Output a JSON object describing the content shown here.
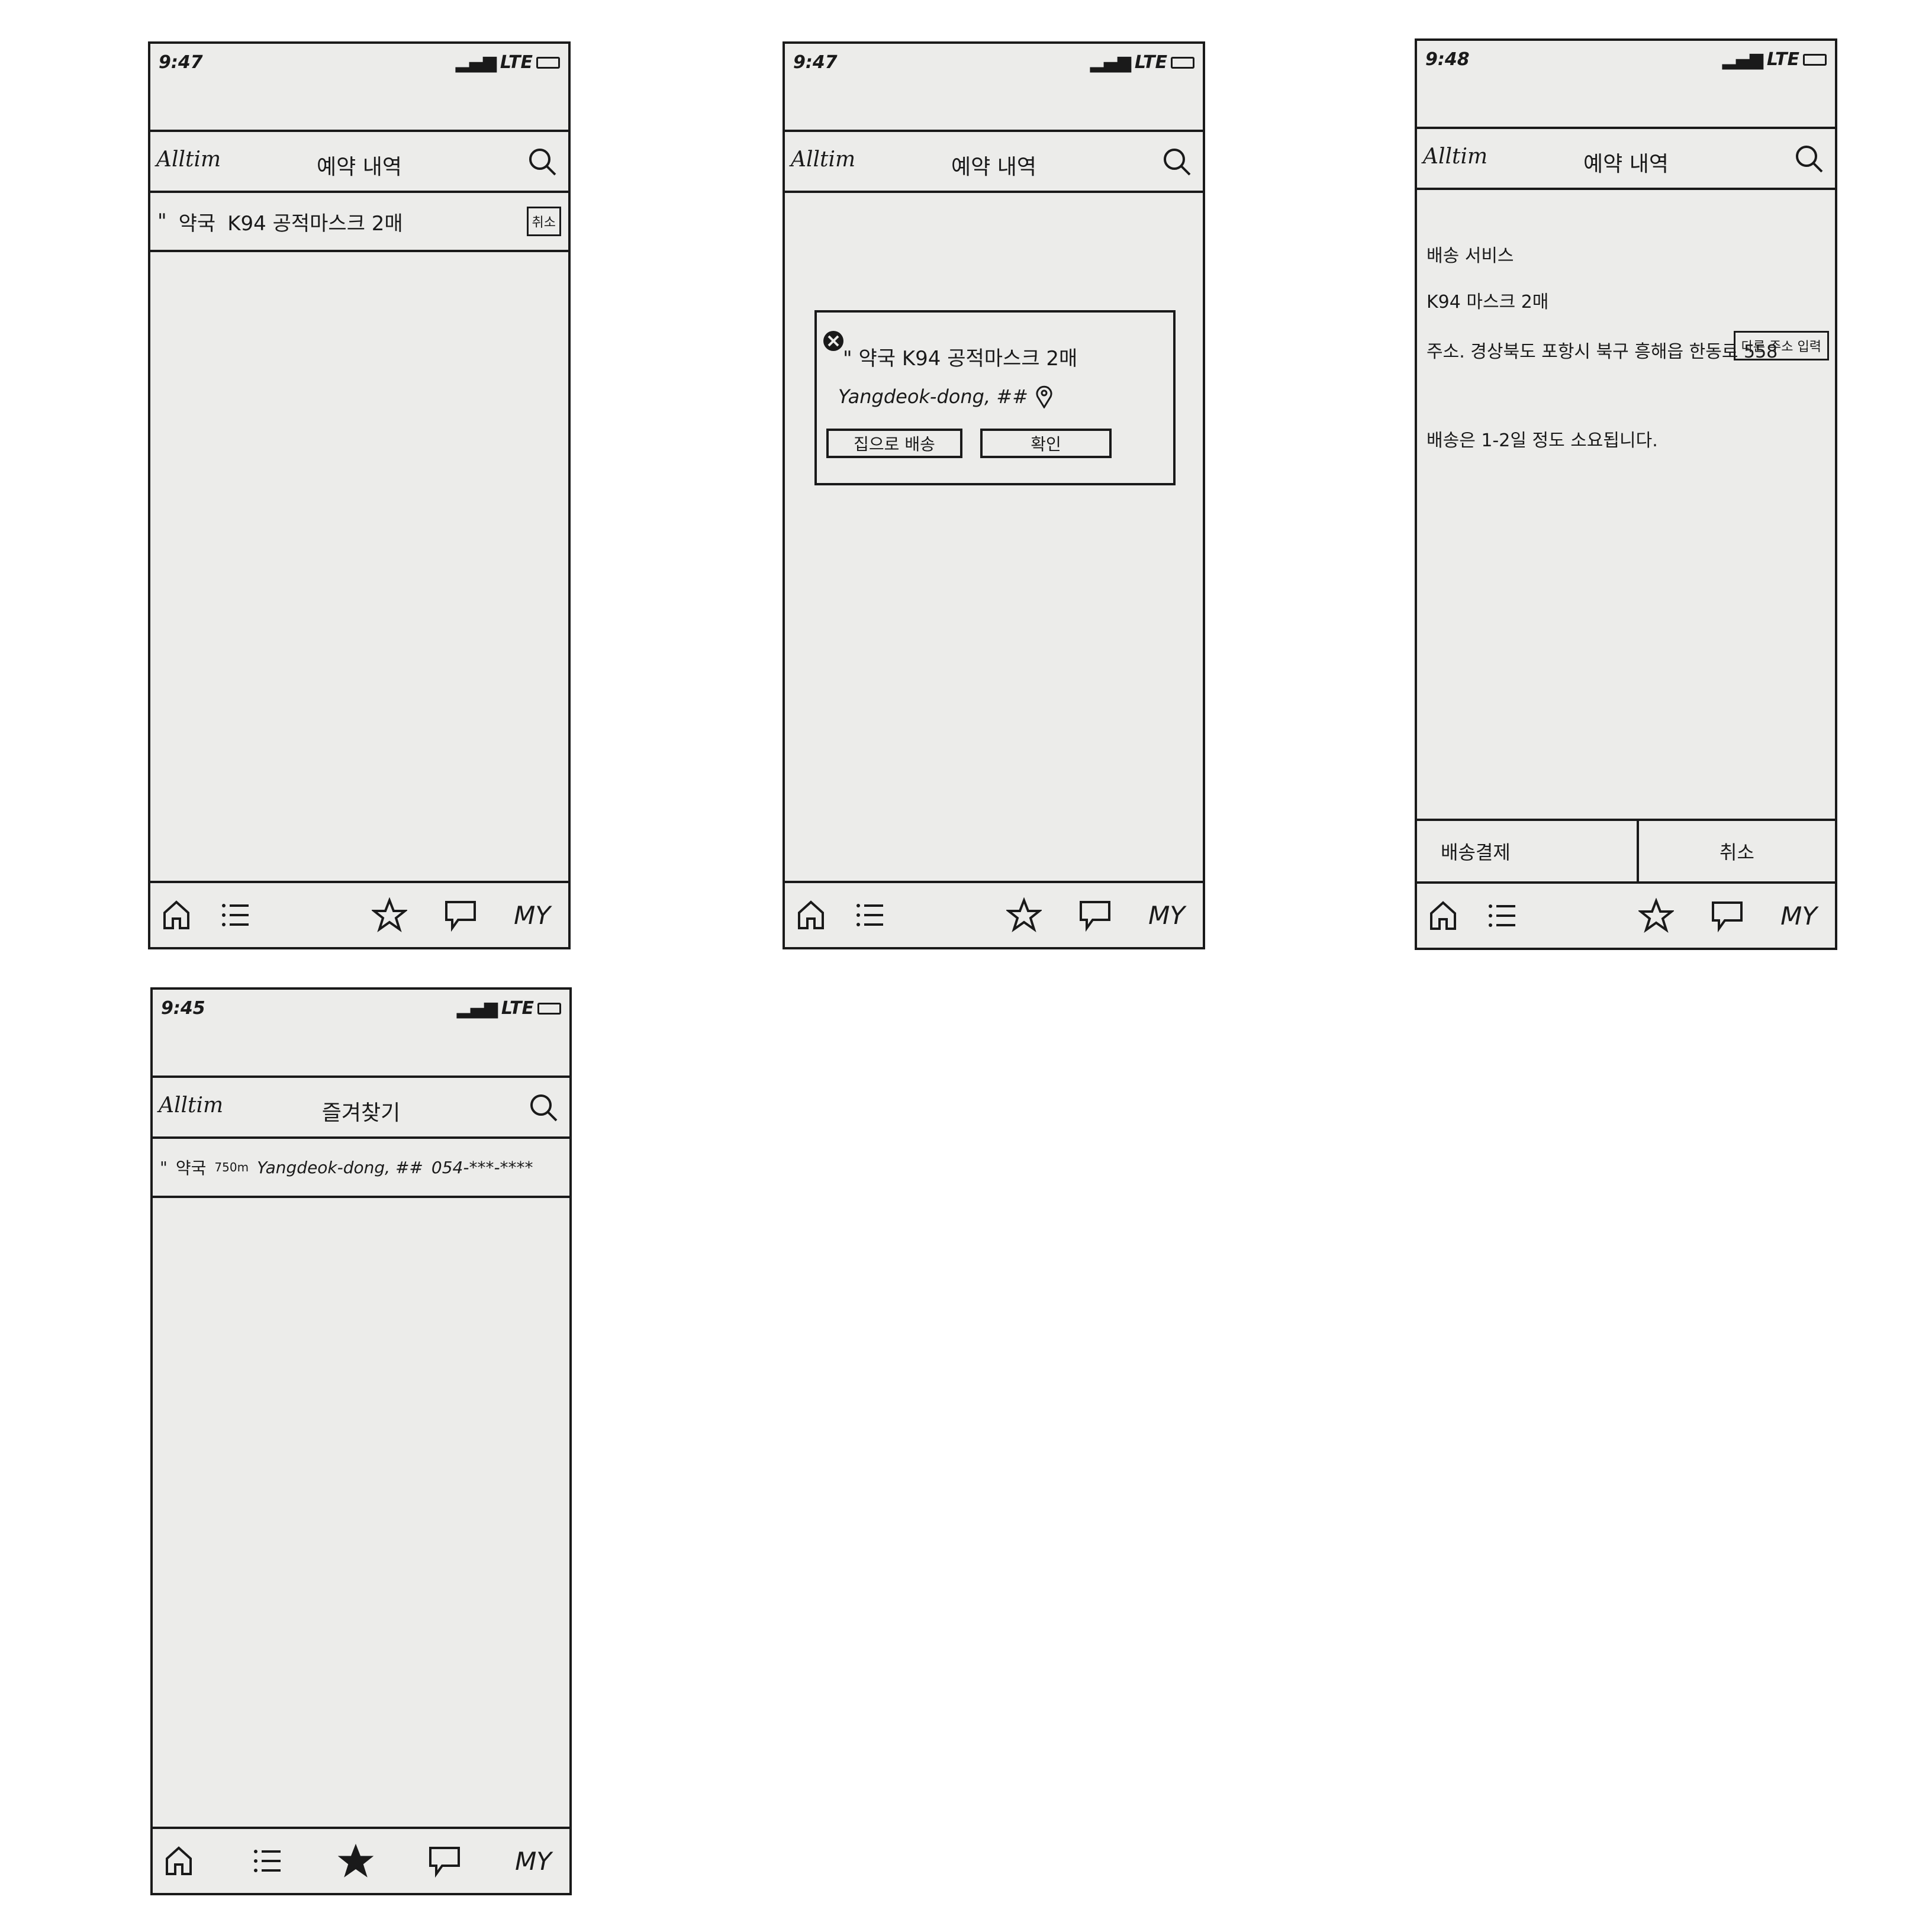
{
  "brand": "Alltim",
  "screens": [
    {
      "time": "9:47",
      "network": "LTE",
      "title": "예약 내역",
      "row": {
        "quote": "\"",
        "store": "약국",
        "item": "K94 공적마스크 2매",
        "cancel_label": "취소"
      }
    },
    {
      "time": "9:47",
      "network": "LTE",
      "title": "예약 내역",
      "popup": {
        "quote": "\"",
        "store": "약국",
        "item": "K94 공적마스크 2매",
        "address": "Yangdeok-dong, ##",
        "delivery_button": "집으로 배송",
        "confirm_button": "확인"
      }
    },
    {
      "time": "9:48",
      "network": "LTE",
      "title": "예약 내역",
      "details": {
        "service": "배송 서비스",
        "item": "K94 마스크 2매",
        "address_label": "주소.",
        "address": "경상북도 포항시 북구 흥해읍 한동로 558",
        "other_address_button": "다른 주소 입력",
        "delivery_note": "배송은 1-2일 정도 소요됩니다."
      },
      "actions": {
        "pay": "배송결제",
        "cancel": "취소"
      }
    },
    {
      "time": "9:45",
      "network": "LTE",
      "title": "즐겨찾기",
      "row": {
        "quote": "\"",
        "store": "약국",
        "distance": "750m",
        "address": "Yangdeok-dong, ##",
        "phone": "054-***-****"
      }
    }
  ],
  "tabbar": {
    "my_label": "MY"
  }
}
